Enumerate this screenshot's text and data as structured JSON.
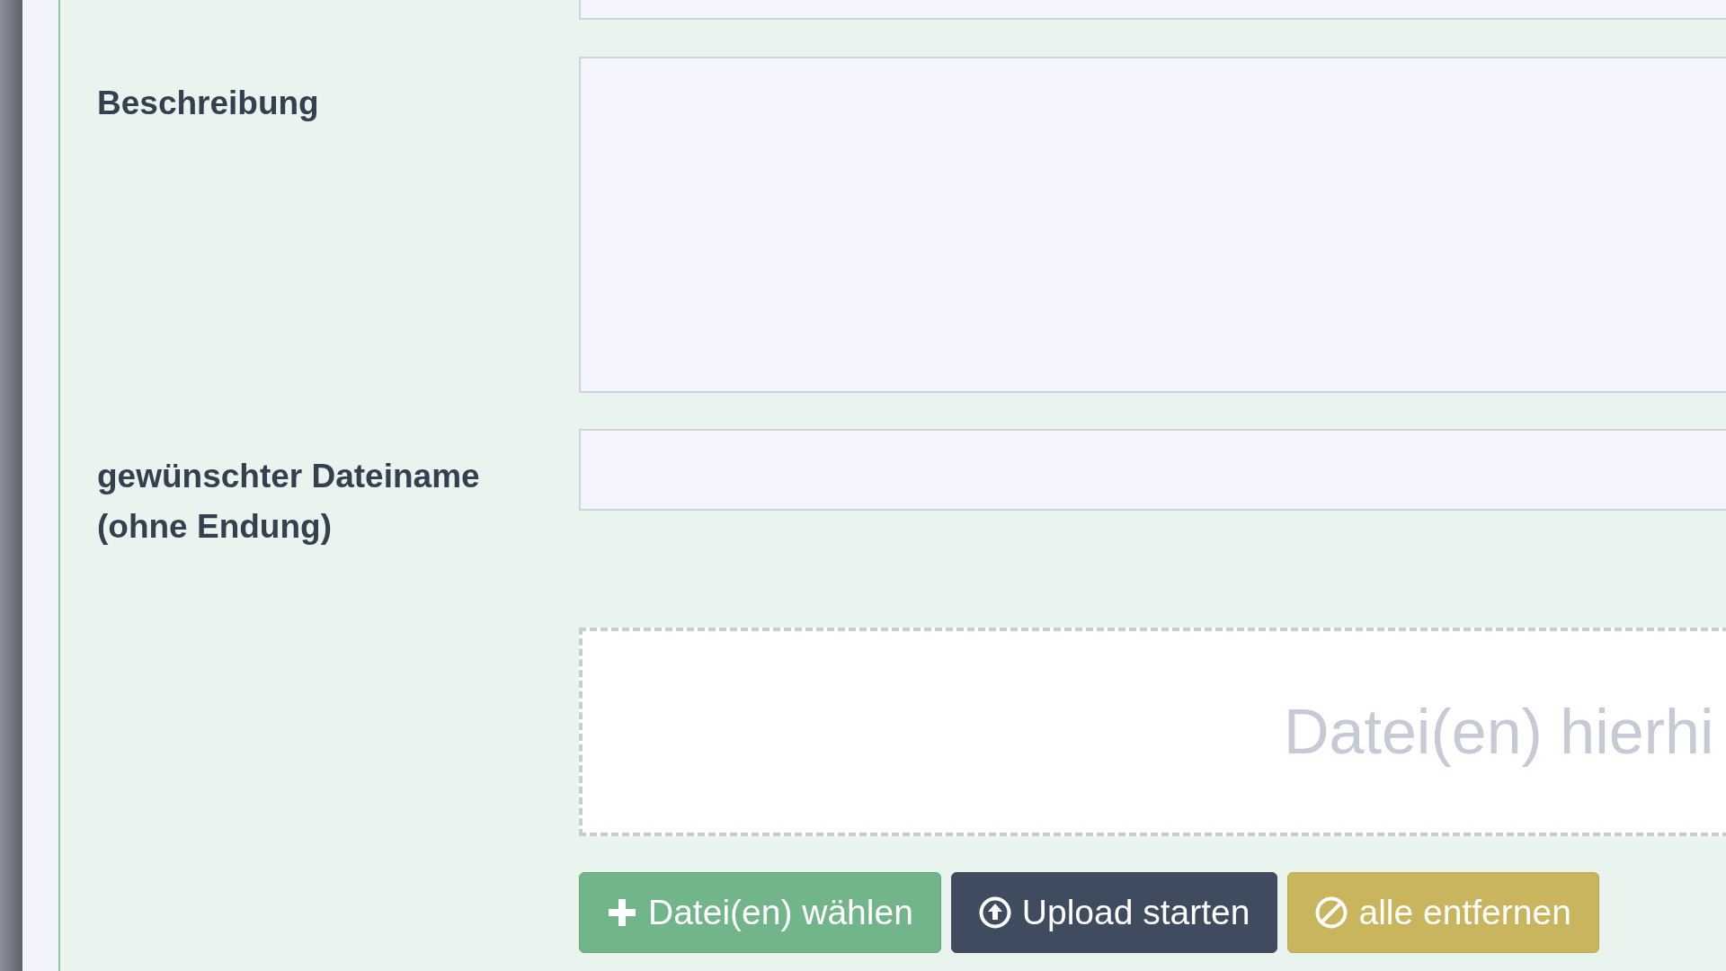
{
  "fields": [
    {
      "kind": "input"
    },
    {
      "kind": "textarea",
      "label": "Beschreibung"
    },
    {
      "kind": "input",
      "label": "gewünschter Dateiname (ohne Endung)"
    }
  ],
  "dropzone": {
    "text": "Datei(en) hierhi"
  },
  "buttons": [
    {
      "kind": "add",
      "label": "Datei(en) wählen"
    },
    {
      "kind": "upload",
      "label": "Upload starten"
    },
    {
      "kind": "cancel",
      "label": "alle entfernen"
    }
  ]
}
